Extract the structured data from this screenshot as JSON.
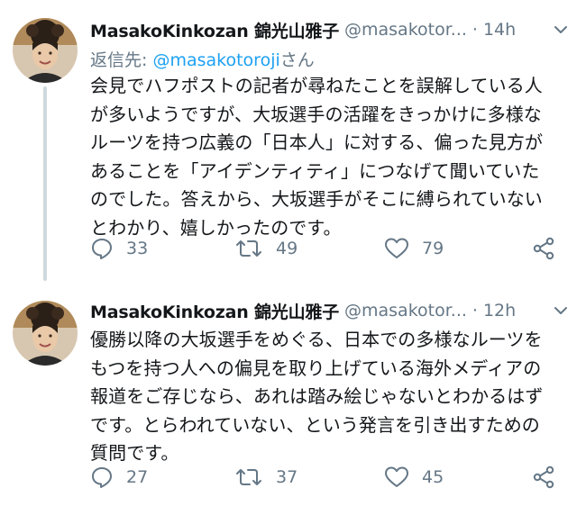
{
  "tweets": [
    {
      "display_name": "MasakoKinkozan 錦光山雅子",
      "handle": "@masakotor...",
      "separator": "·",
      "time": "14h",
      "reply_prefix": "返信先: ",
      "reply_mention": "@masakotoroji",
      "reply_suffix": "さん",
      "lines": [
        "会見でハフポストの記者が尋ねたことを誤解している人",
        "が多いようですが、大坂選手の活躍をきっかけに多様な",
        "ルーツを持つ広義の「日本人」に対する、偏った見方が",
        "あることを「アイデンティティ」につなげて聞いていた",
        "のでした。答えから、大坂選手がそこに縛られていない",
        "とわかり、嬉しかったのです。"
      ],
      "replies": "33",
      "retweets": "49",
      "likes": "79"
    },
    {
      "display_name": "MasakoKinkozan 錦光山雅子",
      "handle": "@masakotor...",
      "separator": "·",
      "time": "12h",
      "lines": [
        "優勝以降の大坂選手をめぐる、日本での多様なルーツを",
        "もつを持つ人への偏見を取り上げている海外メディアの",
        "報道をご存じなら、あれは踏み絵じゃないとわかるはず",
        "です。とらわれていない、という発言を引き出すための",
        "質問です。"
      ],
      "replies": "27",
      "retweets": "37",
      "likes": "45"
    }
  ],
  "icons": {
    "reply": "reply-icon",
    "retweet": "retweet-icon",
    "like": "heart-icon",
    "share": "share-icon",
    "caret": "chevron-down-icon"
  },
  "colors": {
    "secondary_text": "#657786",
    "link": "#1da1f2",
    "thread_line": "#cfd9de"
  }
}
